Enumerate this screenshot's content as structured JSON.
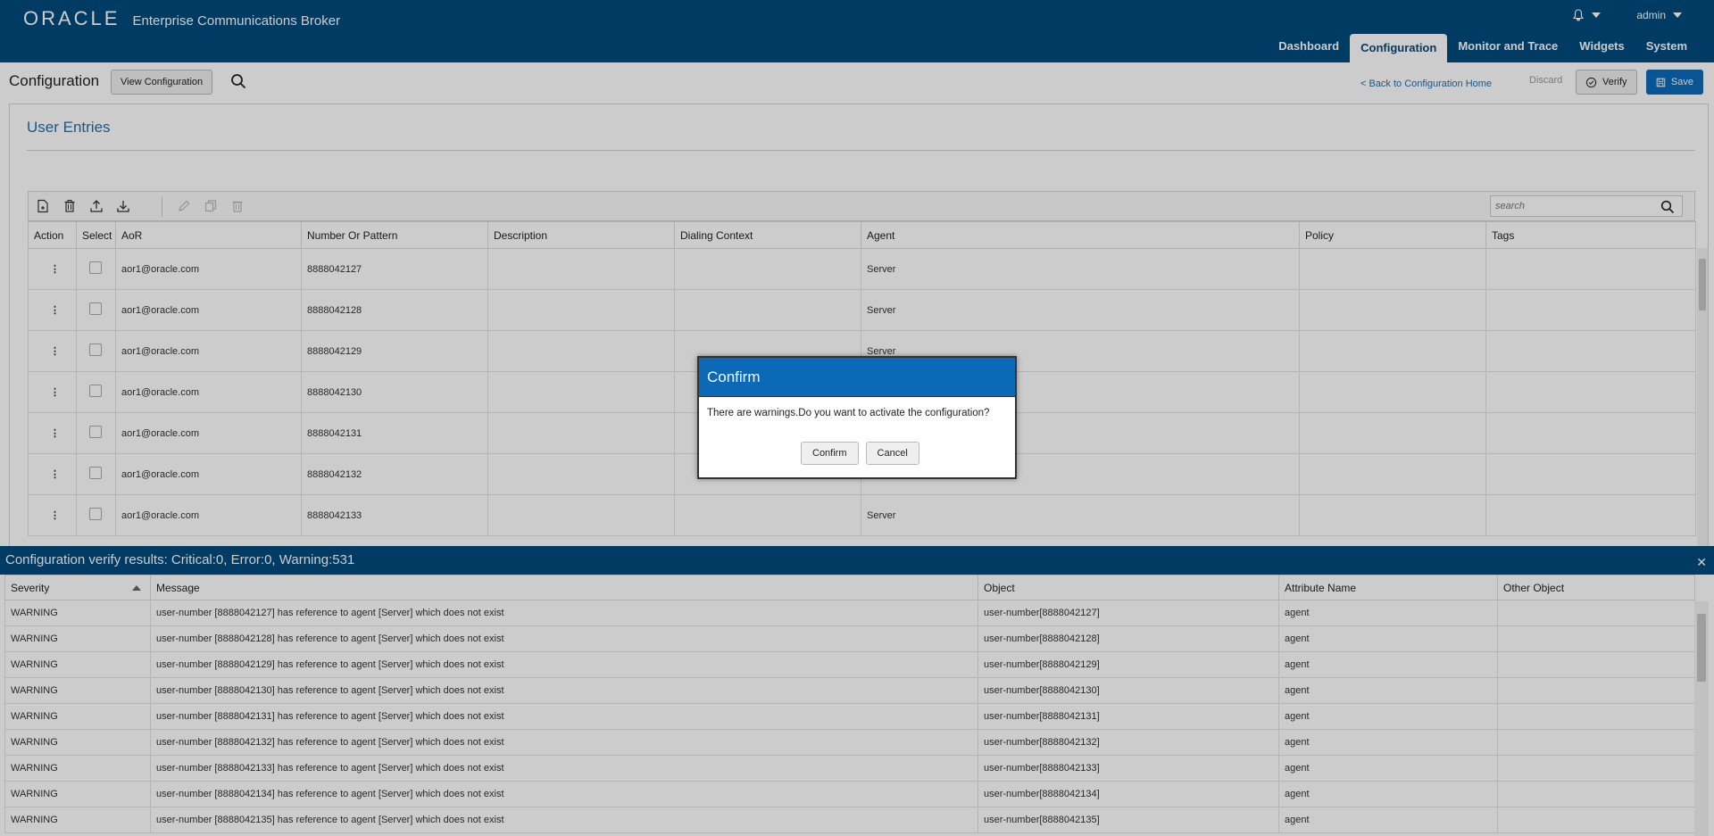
{
  "header": {
    "logo": "ORACLE",
    "product": "Enterprise Communications Broker",
    "user": "admin",
    "nav_tabs": [
      "Dashboard",
      "Configuration",
      "Monitor and Trace",
      "Widgets",
      "System"
    ],
    "active_tab": "Configuration"
  },
  "subheader": {
    "title": "Configuration",
    "view_button": "View Configuration",
    "back_link": "< Back to Configuration Home",
    "discard": "Discard",
    "verify": "Verify",
    "save": "Save"
  },
  "section": {
    "title": "User Entries",
    "search_placeholder": "search",
    "columns": [
      "Action",
      "Select",
      "AoR",
      "Number Or Pattern",
      "Description",
      "Dialing Context",
      "Agent",
      "Policy",
      "Tags"
    ],
    "rows": [
      {
        "aor": "aor1@oracle.com",
        "number": "8888042127",
        "description": "",
        "dialing_context": "",
        "agent": "Server",
        "policy": "",
        "tags": ""
      },
      {
        "aor": "aor1@oracle.com",
        "number": "8888042128",
        "description": "",
        "dialing_context": "",
        "agent": "Server",
        "policy": "",
        "tags": ""
      },
      {
        "aor": "aor1@oracle.com",
        "number": "8888042129",
        "description": "",
        "dialing_context": "",
        "agent": "Server",
        "policy": "",
        "tags": ""
      },
      {
        "aor": "aor1@oracle.com",
        "number": "8888042130",
        "description": "",
        "dialing_context": "",
        "agent": "",
        "policy": "",
        "tags": ""
      },
      {
        "aor": "aor1@oracle.com",
        "number": "8888042131",
        "description": "",
        "dialing_context": "",
        "agent": "",
        "policy": "",
        "tags": ""
      },
      {
        "aor": "aor1@oracle.com",
        "number": "8888042132",
        "description": "",
        "dialing_context": "",
        "agent": "",
        "policy": "",
        "tags": ""
      },
      {
        "aor": "aor1@oracle.com",
        "number": "8888042133",
        "description": "",
        "dialing_context": "",
        "agent": "Server",
        "policy": "",
        "tags": ""
      }
    ]
  },
  "dialog": {
    "title": "Confirm",
    "message": "There are warnings.Do you want to activate the configuration?",
    "confirm": "Confirm",
    "cancel": "Cancel"
  },
  "results": {
    "title": "Configuration verify results: Critical:0, Error:0, Warning:531",
    "columns": [
      "Severity",
      "Message",
      "Object",
      "Attribute Name",
      "Other Object"
    ],
    "rows": [
      {
        "severity": "WARNING",
        "message": "user-number [8888042127] has reference to agent [Server] which does not exist",
        "object": "user-number[8888042127]",
        "attribute": "agent",
        "other": ""
      },
      {
        "severity": "WARNING",
        "message": "user-number [8888042128] has reference to agent [Server] which does not exist",
        "object": "user-number[8888042128]",
        "attribute": "agent",
        "other": ""
      },
      {
        "severity": "WARNING",
        "message": "user-number [8888042129] has reference to agent [Server] which does not exist",
        "object": "user-number[8888042129]",
        "attribute": "agent",
        "other": ""
      },
      {
        "severity": "WARNING",
        "message": "user-number [8888042130] has reference to agent [Server] which does not exist",
        "object": "user-number[8888042130]",
        "attribute": "agent",
        "other": ""
      },
      {
        "severity": "WARNING",
        "message": "user-number [8888042131] has reference to agent [Server] which does not exist",
        "object": "user-number[8888042131]",
        "attribute": "agent",
        "other": ""
      },
      {
        "severity": "WARNING",
        "message": "user-number [8888042132] has reference to agent [Server] which does not exist",
        "object": "user-number[8888042132]",
        "attribute": "agent",
        "other": ""
      },
      {
        "severity": "WARNING",
        "message": "user-number [8888042133] has reference to agent [Server] which does not exist",
        "object": "user-number[8888042133]",
        "attribute": "agent",
        "other": ""
      },
      {
        "severity": "WARNING",
        "message": "user-number [8888042134] has reference to agent [Server] which does not exist",
        "object": "user-number[8888042134]",
        "attribute": "agent",
        "other": ""
      },
      {
        "severity": "WARNING",
        "message": "user-number [8888042135] has reference to agent [Server] which does not exist",
        "object": "user-number[8888042135]",
        "attribute": "agent",
        "other": ""
      }
    ]
  },
  "colors": {
    "header_bg": "#004a7c",
    "accent": "#0c69b8",
    "link": "#1f6fb3",
    "warning": "#c74634"
  }
}
